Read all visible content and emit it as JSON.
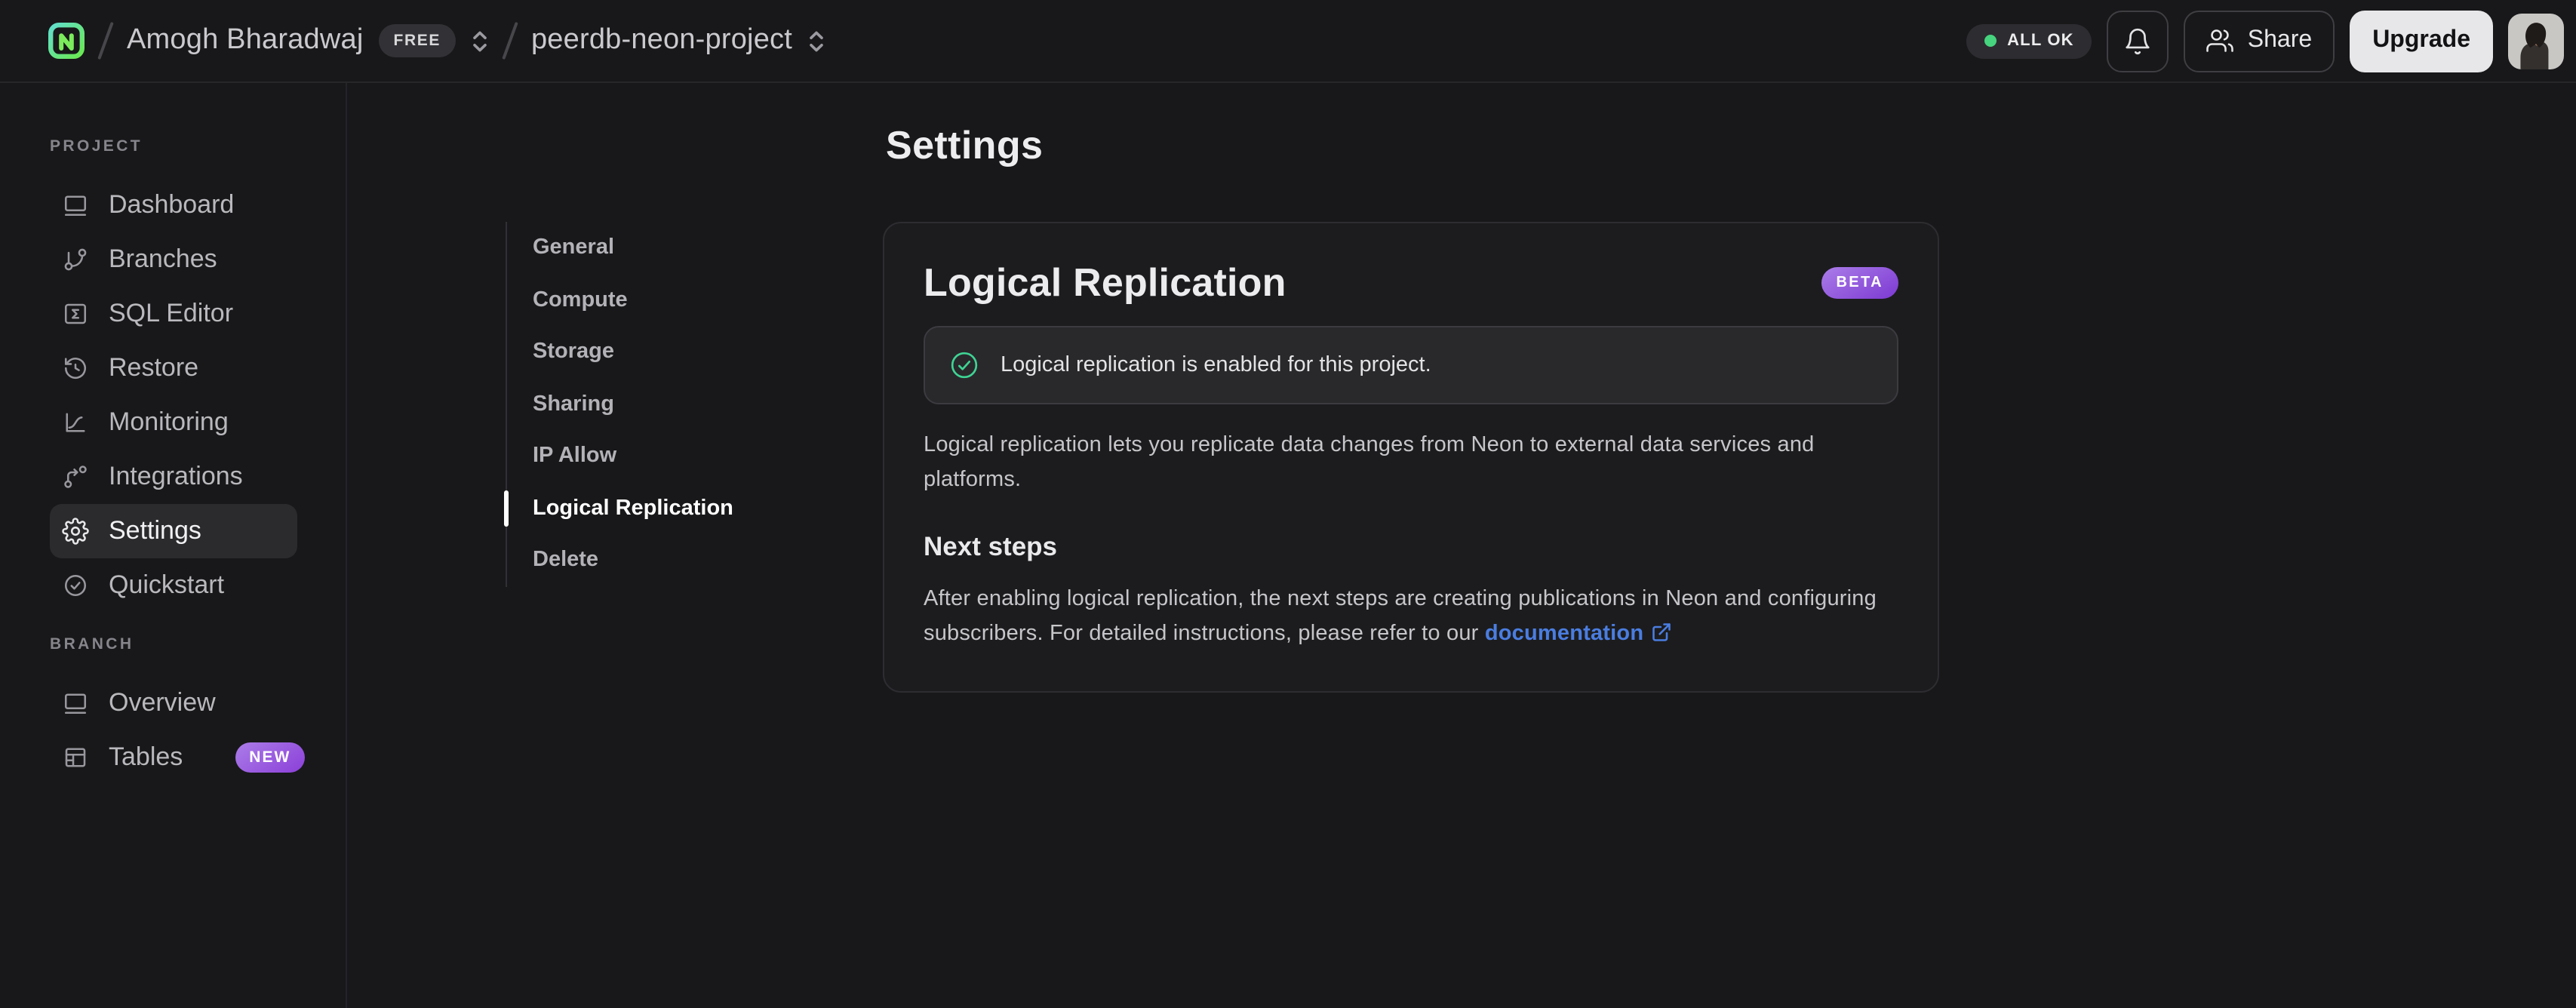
{
  "topbar": {
    "account_name": "Amogh Bharadwaj",
    "plan_badge": "FREE",
    "project_name": "peerdb-neon-project",
    "status_label": "ALL OK",
    "share_label": "Share",
    "upgrade_label": "Upgrade"
  },
  "sidebar": {
    "sections": [
      {
        "label": "PROJECT",
        "items": [
          {
            "label": "Dashboard",
            "icon": "dashboard-icon"
          },
          {
            "label": "Branches",
            "icon": "git-branch-icon"
          },
          {
            "label": "SQL Editor",
            "icon": "sql-editor-icon"
          },
          {
            "label": "Restore",
            "icon": "history-clock-icon"
          },
          {
            "label": "Monitoring",
            "icon": "chart-curve-icon"
          },
          {
            "label": "Integrations",
            "icon": "integrations-flow-icon"
          },
          {
            "label": "Settings",
            "icon": "gear-icon",
            "active": true
          },
          {
            "label": "Quickstart",
            "icon": "check-circle-icon"
          }
        ]
      },
      {
        "label": "BRANCH",
        "items": [
          {
            "label": "Overview",
            "icon": "window-icon"
          },
          {
            "label": "Tables",
            "icon": "table-icon",
            "badge": "NEW"
          }
        ]
      }
    ]
  },
  "main": {
    "page_title": "Settings",
    "settings_nav": [
      "General",
      "Compute",
      "Storage",
      "Sharing",
      "IP Allow",
      "Logical Replication",
      "Delete"
    ],
    "active_nav": "Logical Replication",
    "card": {
      "title": "Logical Replication",
      "beta_badge": "BETA",
      "banner_text": "Logical replication is enabled for this project.",
      "description": "Logical replication lets you replicate data changes from Neon to external data services and platforms.",
      "next_steps_title": "Next steps",
      "next_steps_text": "After enabling logical replication, the next steps are creating publications in Neon and configuring subscribers. For detailed instructions, please refer to our ",
      "doc_link_label": "documentation"
    }
  },
  "colors": {
    "page_bg": "#18181a",
    "card_bg": "#1c1c1e",
    "banner_bg": "#29292c",
    "success_green": "#3fd494",
    "status_dot_green": "#46d47e",
    "badge_purple_start": "#ab7de8",
    "badge_purple_end": "#7c39d2",
    "link_blue": "#4a7de0",
    "logo_teal": "#61dfcd",
    "logo_green": "#6ae84f"
  }
}
